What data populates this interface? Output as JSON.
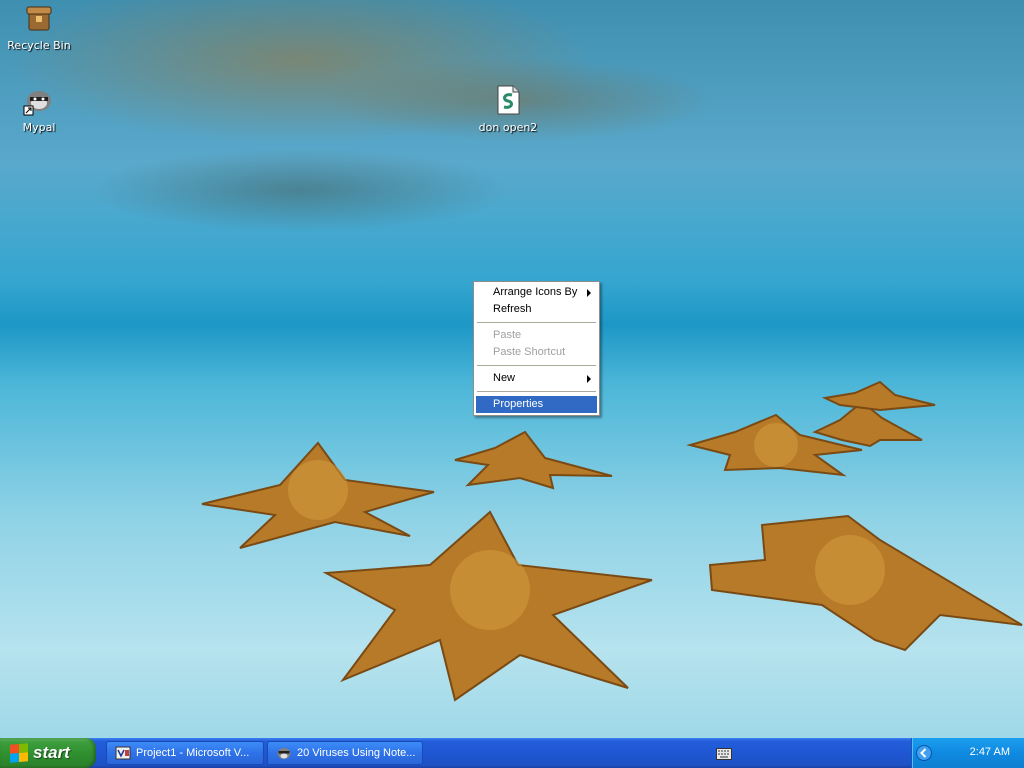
{
  "desktop": {
    "icons": [
      {
        "label": "Recycle Bin",
        "icon": "recycle-bin-icon"
      },
      {
        "label": "Mypal",
        "icon": "mypal-raccoon-icon"
      },
      {
        "label": "don open2",
        "icon": "script-file-icon"
      }
    ]
  },
  "context_menu": {
    "items": [
      {
        "label": "Arrange Icons By",
        "state": "enabled",
        "has_submenu": true
      },
      {
        "label": "Refresh",
        "state": "enabled"
      },
      {
        "label": "Paste",
        "state": "disabled"
      },
      {
        "label": "Paste Shortcut",
        "state": "disabled"
      },
      {
        "label": "New",
        "state": "enabled",
        "has_submenu": true
      },
      {
        "label": "Properties",
        "state": "selected"
      }
    ]
  },
  "taskbar": {
    "start_label": "start",
    "tasks": [
      {
        "label": "Project1 - Microsoft V...",
        "icon": "visual-basic-icon"
      },
      {
        "label": "20 Viruses Using Note...",
        "icon": "raccoon-browser-icon"
      }
    ],
    "tray": {
      "clock": "2:47 AM",
      "icons": [
        "keyboard-icon",
        "show-hidden-icons-icon"
      ]
    }
  },
  "colors": {
    "taskbar_blue": "#245edb",
    "start_green": "#3c9d3c",
    "tray_blue": "#0f8ae0",
    "menu_highlight": "#316ac5"
  }
}
